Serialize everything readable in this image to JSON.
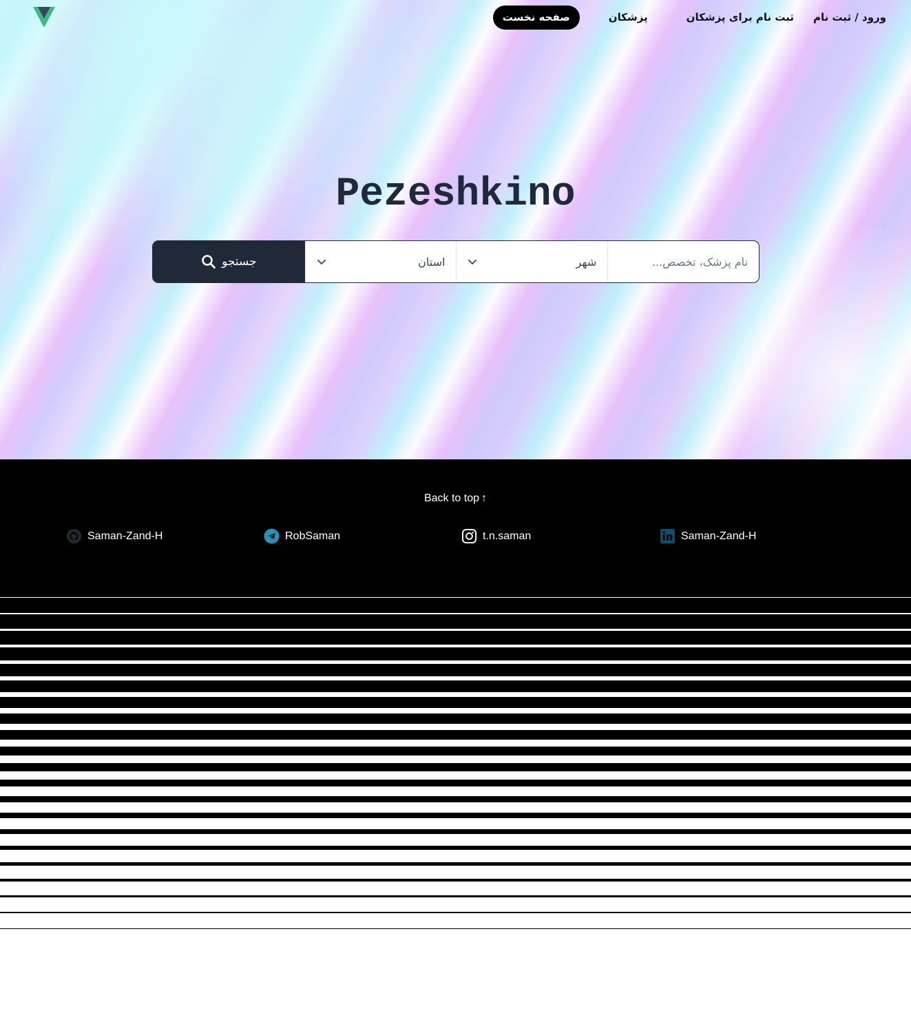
{
  "nav": {
    "logo_icon": "vue-logo-icon",
    "items": [
      {
        "label": "ورود / ثبت نام",
        "active": false
      },
      {
        "label": "ثبت نام برای پزشکان",
        "active": false
      },
      {
        "label": "پزشکان",
        "active": false
      },
      {
        "label": "صفحه نخست",
        "active": true
      }
    ]
  },
  "hero": {
    "title": "Pezeshkino"
  },
  "search": {
    "query_placeholder": "نام پزشک، تخصص...",
    "query_value": "",
    "city_value": "شهر",
    "province_value": "استان",
    "button_label": "جستجو",
    "button_color": "#1f2937"
  },
  "footer": {
    "back_to_top": "Back to top",
    "socials": [
      {
        "icon": "github-icon",
        "label": "Saman-Zand-H"
      },
      {
        "icon": "telegram-icon",
        "label": "RobSaman"
      },
      {
        "icon": "instagram-icon",
        "label": "t.n.saman"
      },
      {
        "icon": "linkedin-icon",
        "label": "Saman-Zand-H"
      }
    ]
  }
}
